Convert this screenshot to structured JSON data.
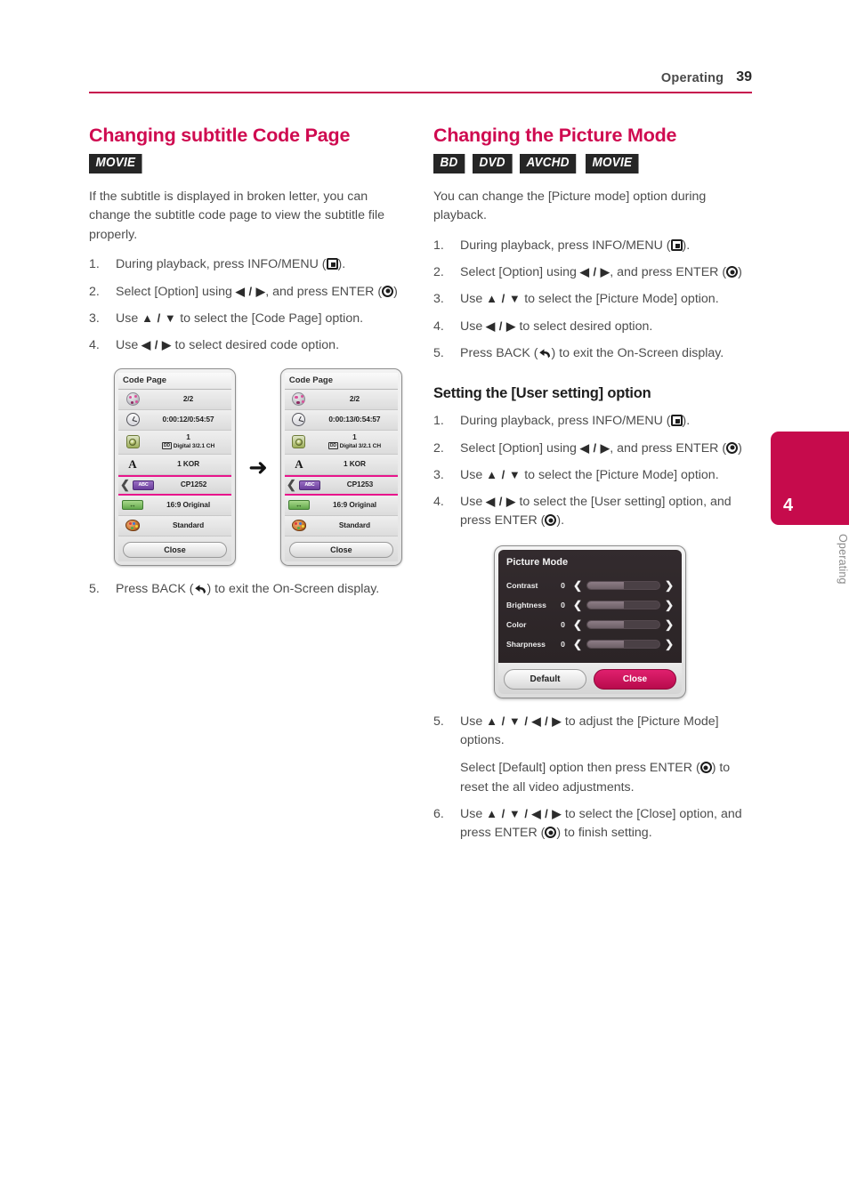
{
  "header": {
    "chapter": "Operating",
    "page_number": "39"
  },
  "side_tab": {
    "number": "4",
    "label": "Operating",
    "color": "#c60b4c"
  },
  "left_column": {
    "title": "Changing subtitle Code Page",
    "badges": [
      "MOVIE"
    ],
    "intro": "If the subtitle is displayed in broken letter, you can change the subtitle code page to view the subtitle file properly.",
    "steps": [
      {
        "num": "1.",
        "pre": "During playback, press INFO/MENU (",
        "icon": "home-icon",
        "post": ")."
      },
      {
        "num": "2.",
        "pre": "Select [Option] using ",
        "nav": "◀ / ▶",
        "mid": ", and press ENTER (",
        "icon": "enter-icon",
        "post": ")"
      },
      {
        "num": "3.",
        "pre": "Use ",
        "nav": "▲ / ▼",
        "mid": " to select the [Code Page] option.",
        "icon": "",
        "post": ""
      },
      {
        "num": "4.",
        "pre": "Use ",
        "nav": "◀ / ▶",
        "mid": " to select desired code option.",
        "icon": "",
        "post": ""
      }
    ],
    "final_step": {
      "num": "5.",
      "pre": "Press BACK (",
      "icon": "back-icon",
      "post": ") to exit the On-Screen display."
    },
    "osd_before": {
      "title": "Code Page",
      "rows": [
        {
          "icon": "film-reel-icon",
          "value": "2/2",
          "sub": ""
        },
        {
          "icon": "clock-icon",
          "value": "0:00:12/0:54:57",
          "sub": ""
        },
        {
          "icon": "disc-audio-icon",
          "value": "1",
          "sub": "Digital    3/2.1 CH",
          "sub_prefix": "DD"
        },
        {
          "icon": "subtitle-A-icon",
          "value": "1 KOR",
          "sub": ""
        },
        {
          "icon": "code-page-abc-icon",
          "value": "CP1252",
          "sub": "",
          "selected": true,
          "badge": "ABC"
        },
        {
          "icon": "aspect-ratio-icon",
          "value": "16:9 Original",
          "sub": ""
        },
        {
          "icon": "picture-mode-palette-icon",
          "value": "Standard",
          "sub": ""
        }
      ],
      "close_label": "Close"
    },
    "osd_after": {
      "title": "Code Page",
      "rows": [
        {
          "icon": "film-reel-icon",
          "value": "2/2",
          "sub": ""
        },
        {
          "icon": "clock-icon",
          "value": "0:00:13/0:54:57",
          "sub": ""
        },
        {
          "icon": "disc-audio-icon",
          "value": "1",
          "sub": "Digital    3/2.1 CH",
          "sub_prefix": "DD"
        },
        {
          "icon": "subtitle-A-icon",
          "value": "1 KOR",
          "sub": ""
        },
        {
          "icon": "code-page-abc-icon",
          "value": "CP1253",
          "sub": "",
          "selected": true,
          "badge": "ABC"
        },
        {
          "icon": "aspect-ratio-icon",
          "value": "16:9 Original",
          "sub": ""
        },
        {
          "icon": "picture-mode-palette-icon",
          "value": "Standard",
          "sub": ""
        }
      ],
      "close_label": "Close"
    },
    "transition_arrow": "➜"
  },
  "right_column": {
    "title": "Changing the Picture Mode",
    "badges": [
      "BD",
      "DVD",
      "AVCHD",
      "MOVIE"
    ],
    "intro": "You can change the [Picture mode] option during playback.",
    "steps": [
      {
        "num": "1.",
        "pre": "During playback, press INFO/MENU (",
        "icon": "home-icon",
        "post": ")."
      },
      {
        "num": "2.",
        "pre": "Select [Option] using ",
        "nav": "◀ / ▶",
        "mid": ", and press ENTER (",
        "icon": "enter-icon",
        "post": ")"
      },
      {
        "num": "3.",
        "pre": "Use ",
        "nav": "▲ / ▼",
        "mid": " to select the [Picture Mode] option.",
        "icon": "",
        "post": ""
      },
      {
        "num": "4.",
        "pre": "Use ",
        "nav": "◀ / ▶",
        "mid": " to select desired option.",
        "icon": "",
        "post": ""
      },
      {
        "num": "5.",
        "pre": "Press BACK (",
        "icon": "back-icon",
        "mid": "",
        "post": ") to exit the On-Screen display."
      }
    ],
    "subsection": {
      "title": "Setting the [User setting] option",
      "steps": [
        {
          "num": "1.",
          "pre": "During playback, press INFO/MENU (",
          "icon": "home-icon",
          "post": ")."
        },
        {
          "num": "2.",
          "pre": "Select [Option] using ",
          "nav": "◀ / ▶",
          "mid": ", and press ENTER (",
          "icon": "enter-icon",
          "post": ")"
        },
        {
          "num": "3.",
          "pre": "Use ",
          "nav": "▲ / ▼",
          "mid": " to select the [Picture Mode] option.",
          "icon": "",
          "post": ""
        },
        {
          "num": "4.",
          "pre": "Use ",
          "nav": "◀ / ▶",
          "mid": " to select the [User setting] option, and press ENTER (",
          "icon": "enter-icon",
          "post": ")."
        }
      ],
      "steps_after": [
        {
          "num": "5.",
          "pre": "Use ",
          "nav": "▲ / ▼ / ◀ / ▶",
          "mid": " to adjust the [Picture Mode] options.",
          "icon": "",
          "post": ""
        },
        {
          "num": "6.",
          "pre": "Use ",
          "nav": "▲ / ▼ / ◀ / ▶",
          "mid": " to select the [Close] option, and press ENTER (",
          "icon": "enter-icon",
          "post": ") to finish setting."
        }
      ],
      "note": {
        "pre": "Select [Default] option then press ENTER (",
        "icon": "enter-icon",
        "post": ") to reset the all video adjustments."
      }
    },
    "picture_mode_dialog": {
      "title": "Picture Mode",
      "sliders": [
        {
          "label": "Contrast",
          "value": "0",
          "fill_percent": 50
        },
        {
          "label": "Brightness",
          "value": "0",
          "fill_percent": 50
        },
        {
          "label": "Color",
          "value": "0",
          "fill_percent": 50
        },
        {
          "label": "Sharpness",
          "value": "0",
          "fill_percent": 50
        }
      ],
      "left_chevron": "❮",
      "right_chevron": "❯",
      "default_label": "Default",
      "close_label": "Close"
    }
  }
}
